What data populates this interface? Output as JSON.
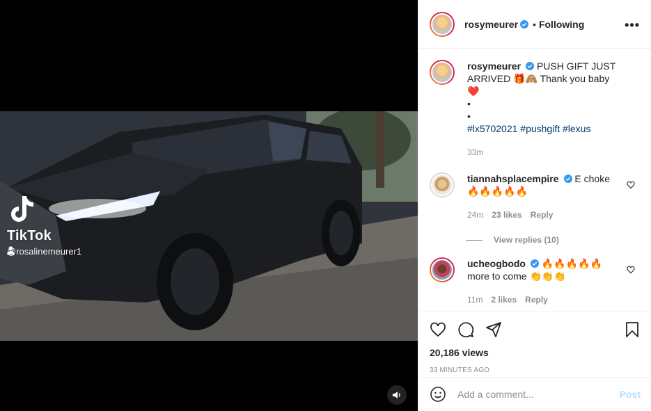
{
  "video": {
    "watermark_brand": "TikTok",
    "watermark_user": "@rosalinemeurer1",
    "sound_icon": "speaker-icon"
  },
  "header": {
    "username": "rosymeurer",
    "separator": "•",
    "follow_status": "Following",
    "more_label": "•••"
  },
  "caption": {
    "username": "rosymeurer",
    "text": "PUSH GIFT JUST ARRIVED 🎁🙈 Thank you baby ❤️",
    "bullet1": "•",
    "bullet2": "•",
    "hashtags": "#lx5702021 #pushgift #lexus",
    "time": "33m"
  },
  "comments": [
    {
      "username": "tiannahsplacempire",
      "text": "E choke 🔥🔥🔥🔥🔥",
      "time": "24m",
      "likes": "23 likes",
      "reply": "Reply",
      "view_replies": "View replies (10)"
    },
    {
      "username": "ucheogbodo",
      "text": "🔥🔥🔥🔥🔥 more to come 👏👏👏",
      "time": "11m",
      "likes": "2 likes",
      "reply": "Reply"
    }
  ],
  "actions": {
    "views": "20,186 views",
    "posted": "33 MINUTES AGO"
  },
  "add_comment": {
    "placeholder": "Add a comment...",
    "post_label": "Post"
  },
  "colors": {
    "link": "#00376b",
    "verified": "#3897f0",
    "post_disabled": "#b2dffc",
    "muted": "#8e8e8e"
  }
}
